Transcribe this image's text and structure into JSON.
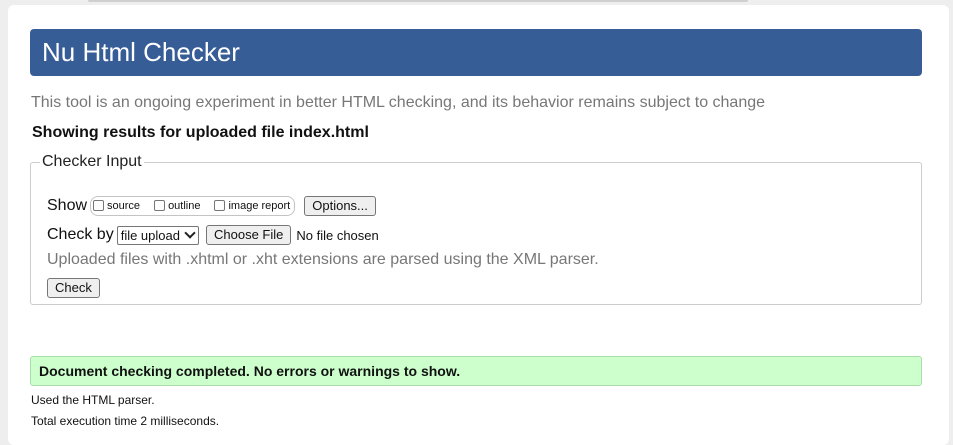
{
  "header": {
    "title": "Nu Html Checker"
  },
  "intro": {
    "text": "This tool is an ongoing experiment in better HTML checking, and its behavior remains subject to change"
  },
  "results_heading": "Showing results for uploaded file index.html",
  "checker_input": {
    "legend": "Checker Input",
    "show_label": "Show",
    "show_options": [
      {
        "label": "source",
        "checked": false
      },
      {
        "label": "outline",
        "checked": false
      },
      {
        "label": "image report",
        "checked": false
      }
    ],
    "options_button": "Options...",
    "check_by_label": "Check by",
    "check_by_selected": "file upload",
    "choose_file_button": "Choose File",
    "file_status": "No file chosen",
    "xml_note": "Uploaded files with .xhtml or .xht extensions are parsed using the XML parser.",
    "submit_button": "Check"
  },
  "result": {
    "message": "Document checking completed. No errors or warnings to show.",
    "parser_info": "Used the HTML parser.",
    "time_info": "Total execution time 2 milliseconds."
  },
  "colors": {
    "header_bg": "#365d95",
    "success_bg": "#ccffcc",
    "muted_text": "#777777"
  }
}
